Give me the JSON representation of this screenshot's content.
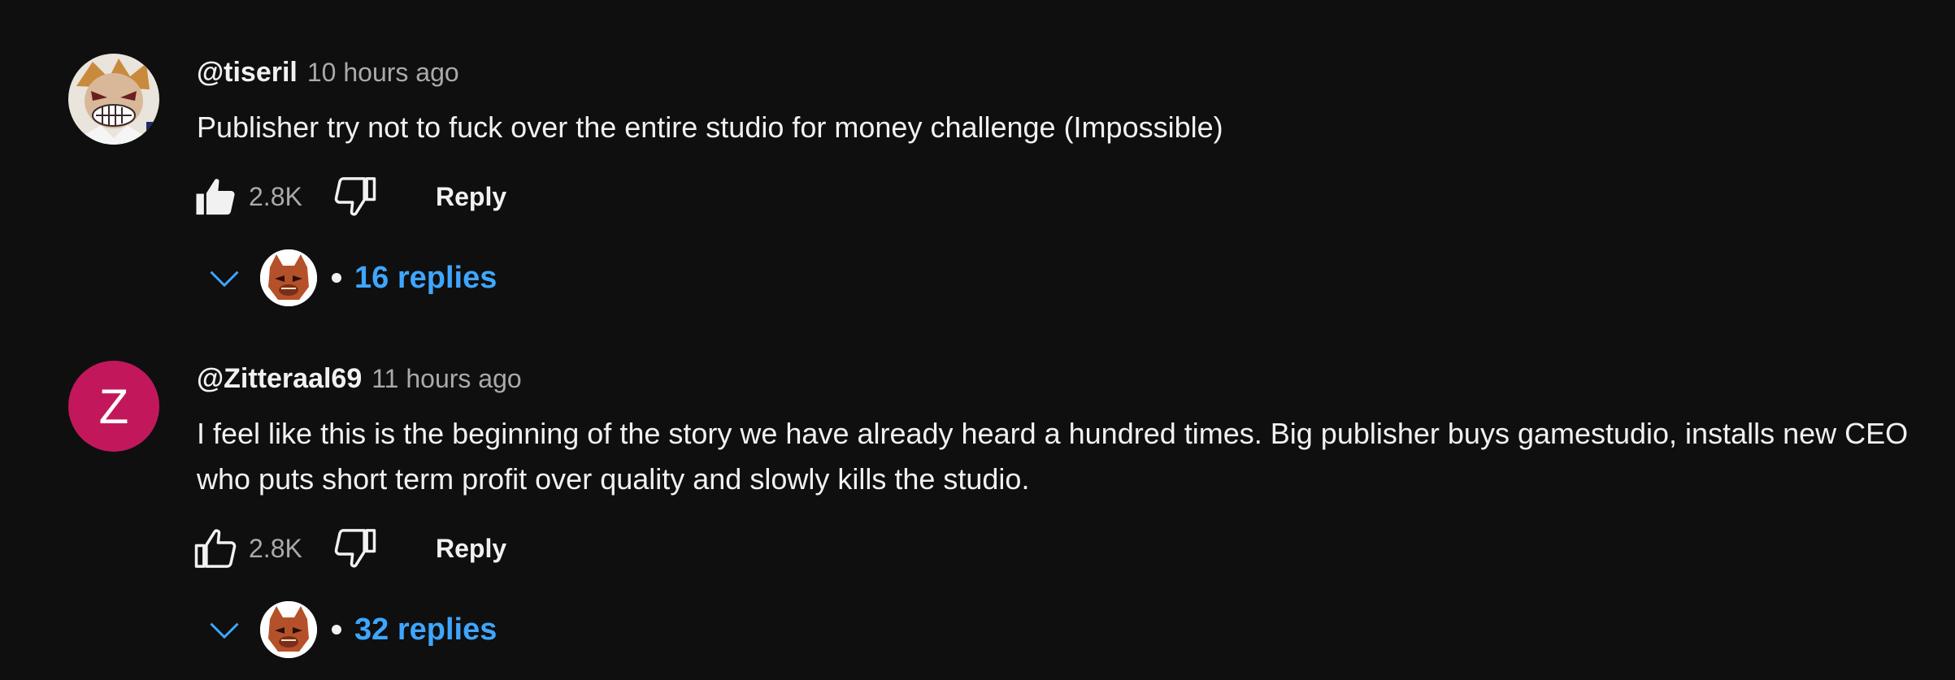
{
  "comments": [
    {
      "author": "@tiseril",
      "time": "10 hours ago",
      "text": "Publisher try not to fuck over the entire studio for money challenge (Impossible)",
      "likes": "2.8K",
      "reply_label": "Reply",
      "replies_label": "16 replies",
      "avatar_icon": "grinning-character-avatar",
      "like_state": "liked"
    },
    {
      "author": "@Zitteraal69",
      "time": "11 hours ago",
      "avatar_letter": "Z",
      "avatar_color": "#c2185b",
      "text": "I feel like this is the beginning of the story we have already heard a hundred times. Big publisher buys gamestudio, installs new CEO who puts short term profit over quality and slowly kills the studio.",
      "likes": "2.8K",
      "reply_label": "Reply",
      "replies_label": "32 replies",
      "like_state": "not-liked"
    }
  ],
  "colors": {
    "background": "#0f0f0f",
    "text": "#f1f1f1",
    "muted": "#aaaaaa",
    "link": "#3ea6ff"
  },
  "icons": {
    "like": "thumbs-up-icon",
    "dislike": "thumbs-down-icon",
    "expand": "chevron-down-icon",
    "replier": "creator-avatar-icon"
  }
}
